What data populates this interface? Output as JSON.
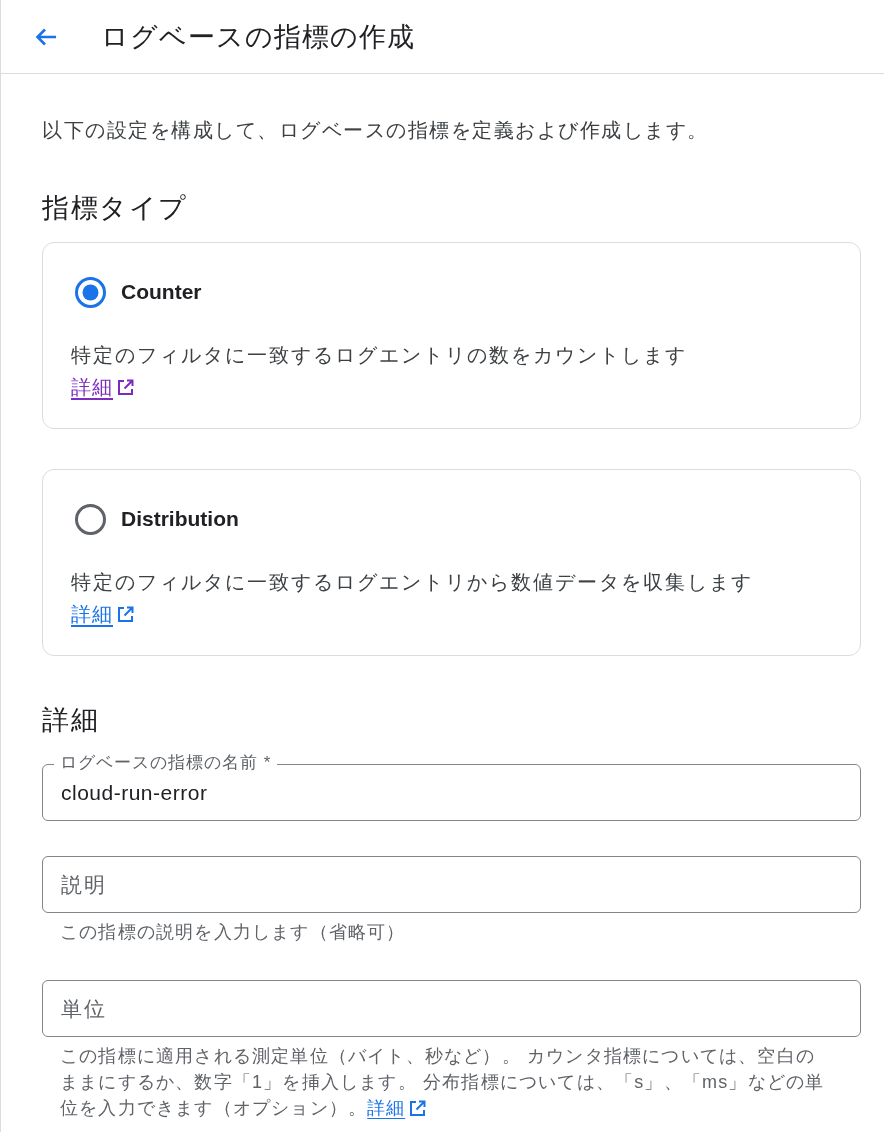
{
  "header": {
    "title": "ログベースの指標の作成"
  },
  "intro": "以下の設定を構成して、ログベースの指標を定義および作成します。",
  "metric_type": {
    "heading": "指標タイプ",
    "options": [
      {
        "label": "Counter",
        "selected": true,
        "description": "特定のフィルタに一致するログエントリの数をカウントします",
        "link": {
          "text": "詳細",
          "visited": true
        }
      },
      {
        "label": "Distribution",
        "selected": false,
        "description": "特定のフィルタに一致するログエントリから数値データを収集します",
        "link": {
          "text": "詳細",
          "visited": false
        }
      }
    ]
  },
  "details": {
    "heading": "詳細",
    "fields": [
      {
        "label": "ログベースの指標の名前 *",
        "value": "cloud-run-error"
      },
      {
        "placeholder": "説明",
        "helper": "この指標の説明を入力します（省略可）"
      },
      {
        "placeholder": "単位",
        "helper": "この指標に適用される測定単位（バイト、秒など）。 カウンタ指標については、空白のままにするか、数字「1」を挿入します。 分布指標については、「s」、「ms」などの単位を入力できます（オプション）。",
        "helper_link": {
          "text": "詳細",
          "visited": false
        }
      }
    ]
  }
}
